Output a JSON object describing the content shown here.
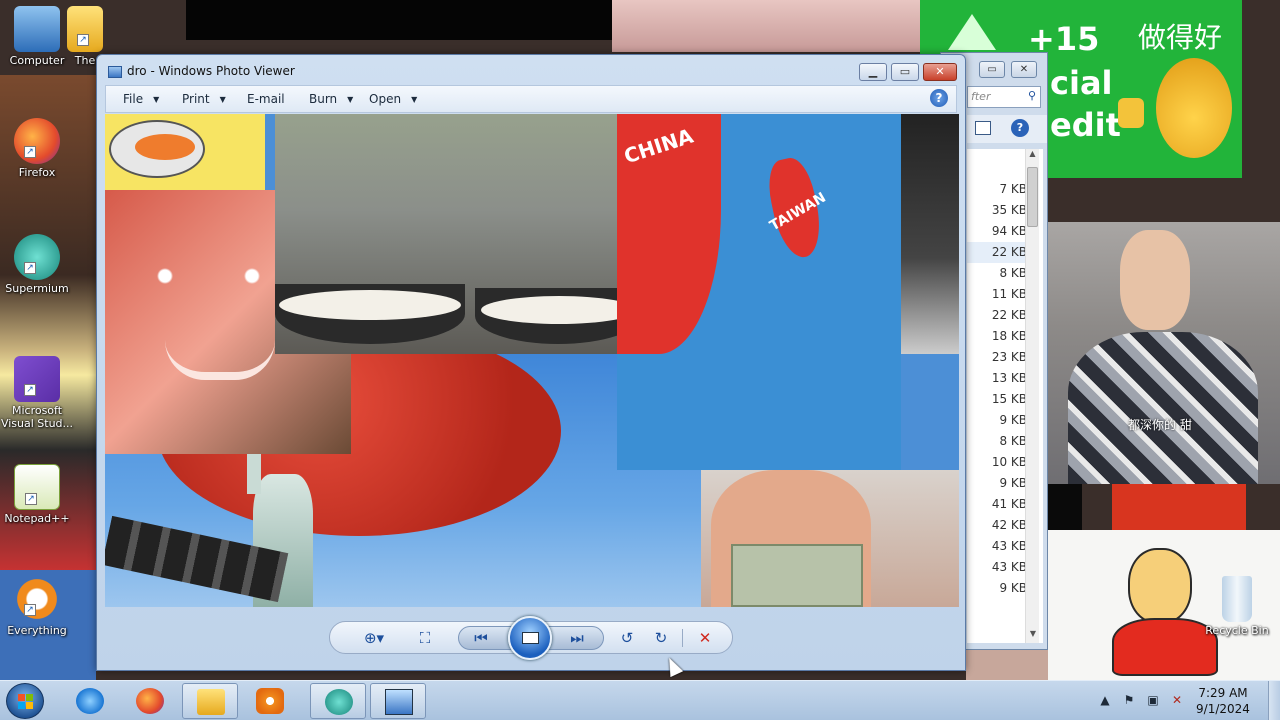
{
  "desktop": {
    "icons": [
      {
        "label": "Computer",
        "icon": "computer-icon"
      },
      {
        "label": "The",
        "icon": "folder-icon"
      },
      {
        "label": "Firefox",
        "icon": "firefox-icon"
      },
      {
        "label": "Supermium",
        "icon": "supermium-icon"
      },
      {
        "label": "Microsoft Visual Stud...",
        "icon": "visual-studio-icon"
      },
      {
        "label": "Notepad++",
        "icon": "notepadpp-icon"
      },
      {
        "label": "Everything",
        "icon": "everything-search-icon"
      },
      {
        "label": "Recycle Bin",
        "icon": "recycle-bin-icon"
      }
    ],
    "wallpaper_texts": {
      "credit_plus": "+15",
      "credit_line1": "cial",
      "credit_line2": "edit",
      "credit_chinese": "做得好",
      "subtitle_chinese": "都深你的 甜"
    }
  },
  "background_window": {
    "search_placeholder": "fter",
    "file_sizes": [
      "7 KB",
      "35 KB",
      "94 KB",
      "22 KB",
      "8 KB",
      "11 KB",
      "22 KB",
      "18 KB",
      "23 KB",
      "13 KB",
      "15 KB",
      "9 KB",
      "8 KB",
      "10 KB",
      "9 KB",
      "41 KB",
      "42 KB",
      "43 KB",
      "43 KB",
      "9 KB"
    ]
  },
  "photo_viewer": {
    "title": "dro - Windows Photo Viewer",
    "menu": {
      "file": "File",
      "print": "Print",
      "email": "E-mail",
      "burn": "Burn",
      "open": "Open"
    },
    "image_texts": {
      "china": "CHINA",
      "taiwan": "TAIWAN"
    }
  },
  "taskbar": {
    "clock_time": "7:29 AM",
    "clock_date": "9/1/2024"
  },
  "colors": {
    "credit_green": "#22b43a",
    "taiwan_blue": "#3b8fd4",
    "china_red": "#e0332c",
    "taskbar": "#b8cde4"
  }
}
